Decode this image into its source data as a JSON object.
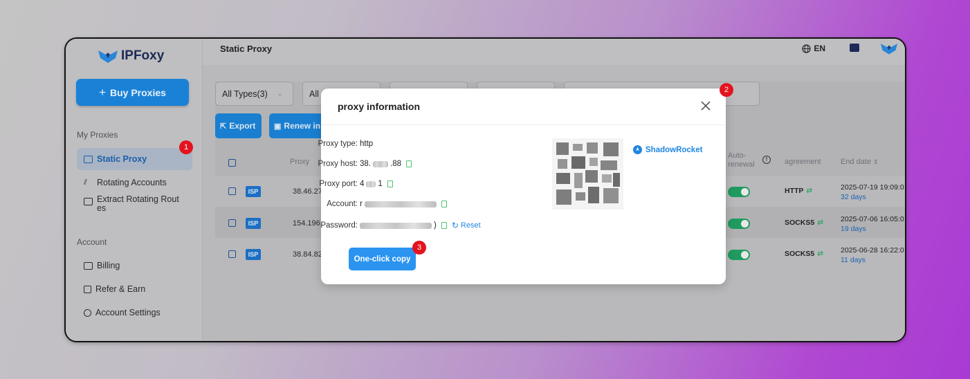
{
  "app": {
    "logo_text": "IPFoxy"
  },
  "sidebar": {
    "buy_label": "Buy Proxies",
    "section_my_proxies": "My Proxies",
    "section_account": "Account",
    "items": [
      {
        "label": "Static Proxy",
        "icon": "monitor-icon"
      },
      {
        "label": "Rotating Accounts",
        "icon": "rotate-icon"
      },
      {
        "label": "Extract Rotating Rout",
        "label_2": "es",
        "icon": "server-icon"
      },
      {
        "label": "Billing",
        "icon": "billing-icon"
      },
      {
        "label": "Refer & Earn",
        "icon": "dollar-icon"
      },
      {
        "label": "Account Settings",
        "icon": "user-icon"
      }
    ]
  },
  "header": {
    "title": "Static Proxy",
    "language": "EN"
  },
  "filters": {
    "type_label": "All Types(3)",
    "second_label": "All"
  },
  "actions": {
    "export_label": "Export",
    "renew_label": "Renew in"
  },
  "table": {
    "headers": {
      "proxy": "Proxy",
      "auto_renewal_1": "Auto-",
      "auto_renewal_2": "renewal",
      "agreement": "agreement",
      "end_date": "End date"
    },
    "rows": [
      {
        "badge": "ISP",
        "ip": "38.46.27",
        "protocol": "HTTP",
        "end_date": "2025-07-19 19:09:0",
        "days": "32 days",
        "auto_renew": true
      },
      {
        "badge": "ISP",
        "ip": "154.196.",
        "protocol": "SOCKS5",
        "end_date": "2025-07-06 16:05:0",
        "days": "19 days",
        "auto_renew": true
      },
      {
        "badge": "ISP",
        "ip": "38.84.82",
        "protocol": "SOCKS5",
        "end_date": "2025-06-28 16:22:0",
        "days": "11 days",
        "auto_renew": true
      }
    ]
  },
  "modal": {
    "title": "proxy information",
    "fields": {
      "type_label": "Proxy type:",
      "type_value": "http",
      "host_label": "Proxy host:",
      "host_prefix": "38.",
      "host_suffix": ".88",
      "port_label": "Proxy port:",
      "port_prefix": "4",
      "port_suffix": "1",
      "account_label": "Account:",
      "account_prefix": "r",
      "password_label": "Password:",
      "password_suffix": ")"
    },
    "reset_label": "Reset",
    "shadowrocket_label": "ShadowRocket",
    "copy_button": "One-click copy"
  },
  "markers": [
    "1",
    "2",
    "3"
  ],
  "colors": {
    "primary": "#1a82d6",
    "modal_blue": "#2a94f0",
    "toggle_green": "#1f9b5f",
    "marker_red": "#e4141e",
    "copy_green": "#4ec270"
  }
}
